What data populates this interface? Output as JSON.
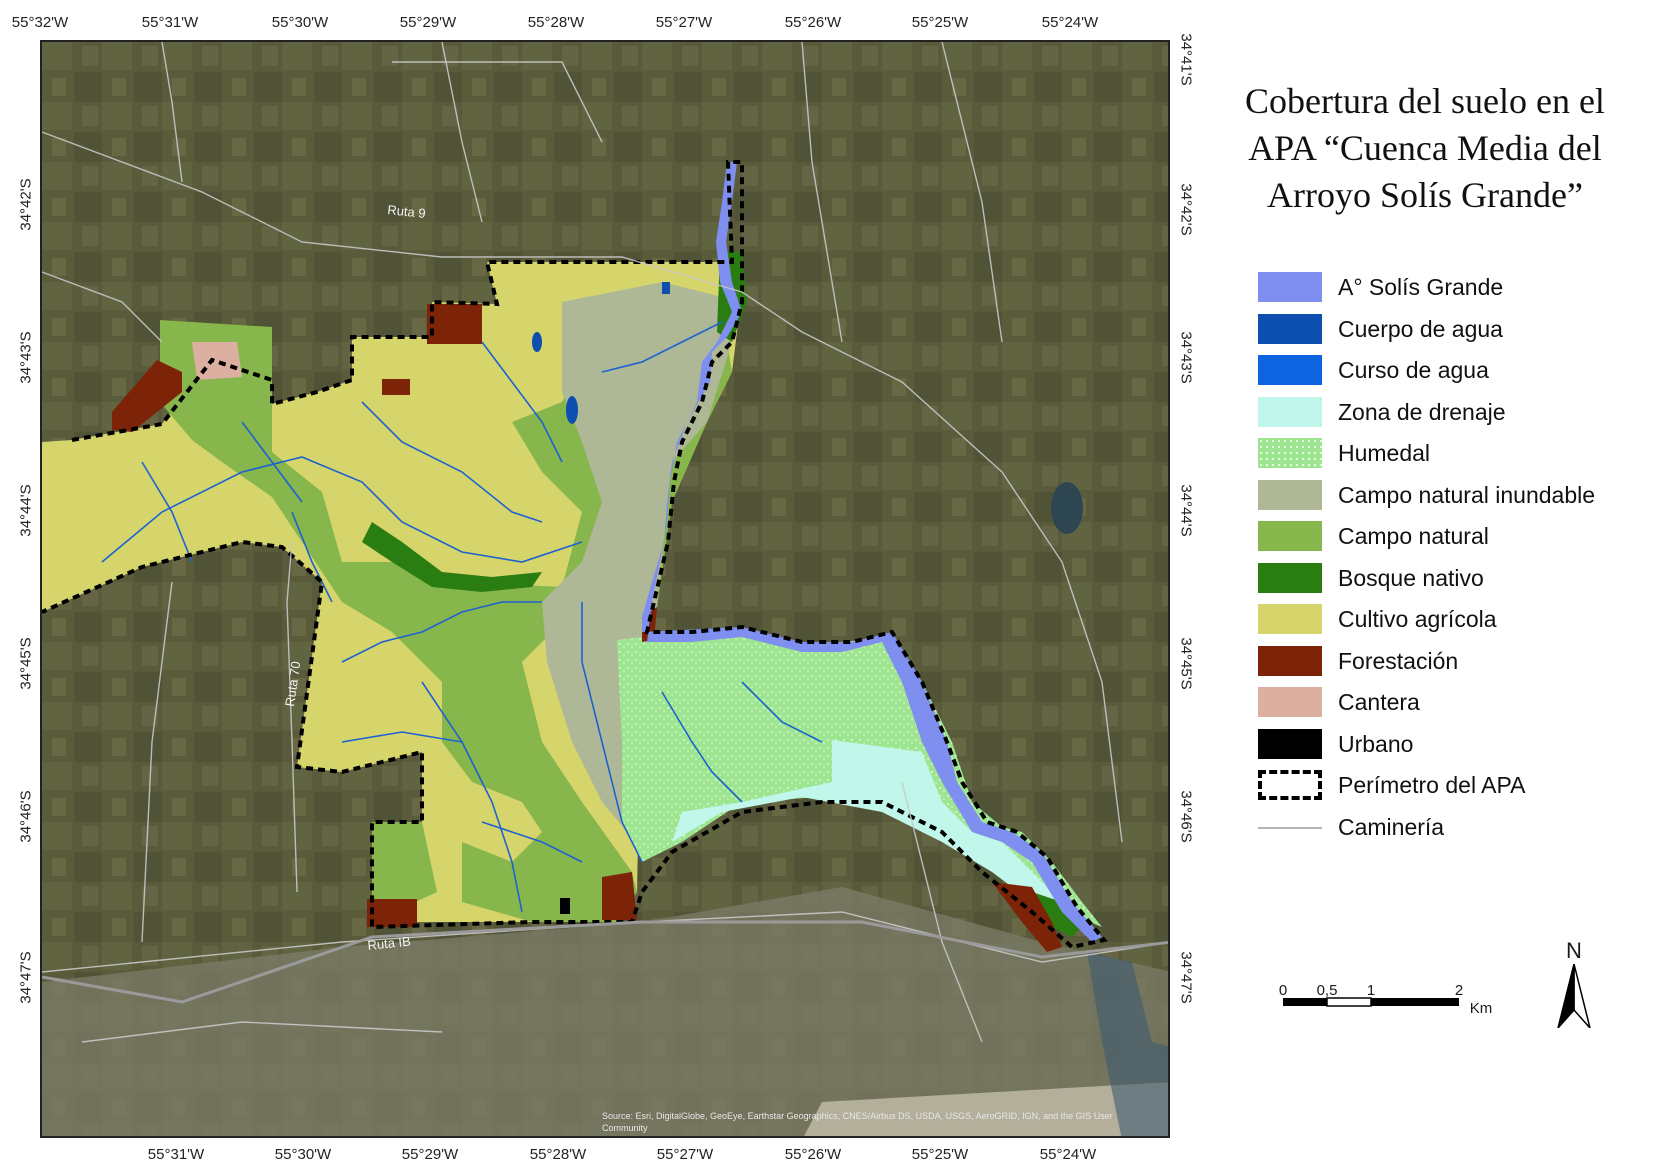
{
  "title": {
    "line1": "Cobertura del suelo en el",
    "line2": "APA “Cuenca Media del",
    "line3": "Arroyo Solís Grande”"
  },
  "axes": {
    "lon_top": [
      "55°32'W",
      "55°31'W",
      "55°30'W",
      "55°29'W",
      "55°28'W",
      "55°27'W",
      "55°26'W",
      "55°25'W",
      "55°24'W"
    ],
    "lon_bottom": [
      "55°31'W",
      "55°30'W",
      "55°29'W",
      "55°28'W",
      "55°27'W",
      "55°26'W",
      "55°25'W",
      "55°24'W"
    ],
    "lat_left": [
      "34°42'S",
      "34°43'S",
      "34°44'S",
      "34°45'S",
      "34°46'S",
      "34°47'S"
    ],
    "lat_right": [
      "34°41'S",
      "34°42'S",
      "34°43'S",
      "34°44'S",
      "34°45'S",
      "34°46'S",
      "34°47'S"
    ]
  },
  "roads": {
    "ruta9": "Ruta 9",
    "ruta70": "Ruta 70",
    "rutaIB": "Ruta IB"
  },
  "legend": [
    {
      "label": "A° Solís Grande",
      "color": "#7f8ff0",
      "kind": "fill"
    },
    {
      "label": "Cuerpo de agua",
      "color": "#0c4faf",
      "kind": "fill"
    },
    {
      "label": "Curso de agua",
      "color": "#0d63e0",
      "kind": "fill"
    },
    {
      "label": "Zona de drenaje",
      "color": "#c0f7ea",
      "kind": "fill"
    },
    {
      "label": "Humedal",
      "color": "#9ee592",
      "kind": "dotted"
    },
    {
      "label": "Campo natural inundable",
      "color": "#afb896",
      "kind": "fill"
    },
    {
      "label": "Campo natural",
      "color": "#86b64c",
      "kind": "fill"
    },
    {
      "label": "Bosque nativo",
      "color": "#2a7d10",
      "kind": "fill"
    },
    {
      "label": "Cultivo agrícola",
      "color": "#d6d56c",
      "kind": "fill"
    },
    {
      "label": "Forestación",
      "color": "#7d2307",
      "kind": "fill"
    },
    {
      "label": "Cantera",
      "color": "#dcb0a0",
      "kind": "fill"
    },
    {
      "label": "Urbano",
      "color": "#000000",
      "kind": "fill"
    },
    {
      "label": "Perímetro del APA",
      "color": "#000000",
      "kind": "dashed"
    },
    {
      "label": "Caminería",
      "color": "#b5b5b5",
      "kind": "line"
    }
  ],
  "scale": {
    "ticks": [
      "0",
      "0,5",
      "1",
      "2"
    ],
    "unit": "Km"
  },
  "north_label": "N",
  "credits": "Source: Esri, DigitalGlobe, GeoEye, Earthstar Geographics, CNES/Airbus DS, USDA, USGS, AeroGRID, IGN, and the GIS User Community"
}
